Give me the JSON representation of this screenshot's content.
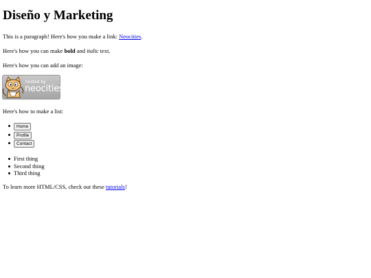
{
  "page": {
    "title": "Diseño y Marketing",
    "para1_text": "This is a paragraph! Here's how you make a link: ",
    "para1_link": "Neocities",
    "para1_end": ".",
    "para2_before": "Here's how you can make ",
    "para2_bold": "bold",
    "para2_mid": " and ",
    "para2_italic": "italic",
    "para2_end": " text.",
    "para3": "Here's how you can add an image:",
    "badge_small": "hosted by",
    "badge_big": "neocities",
    "para4": "Here's how to make a list:",
    "nav_buttons": [
      "Home",
      "Profile",
      "Contact"
    ],
    "list_items": [
      "First thing",
      "Second thing",
      "Third thing"
    ],
    "para5_before": "To learn more HTML/CSS, check out these ",
    "para5_link": "tutorials",
    "para5_end": "!"
  }
}
